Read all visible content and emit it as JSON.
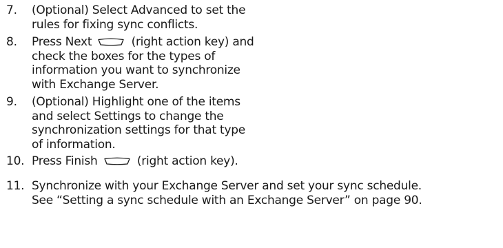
{
  "steps": [
    {
      "number": "7.",
      "lines": [
        "(Optional) Select Advanced to set the",
        "rules for fixing sync conflicts."
      ]
    },
    {
      "number": "8.",
      "line1_before_icon": "Press Next",
      "line1_after_icon": "(right action key) and",
      "lines": [
        "check the boxes for the types of",
        "information you want to synchronize",
        "with Exchange Server."
      ],
      "icon": "right-action-key-icon"
    },
    {
      "number": "9.",
      "lines": [
        "(Optional) Highlight one of the items",
        "and select Settings to change the",
        "synchronization settings for that type",
        "of information."
      ]
    },
    {
      "number": "10.",
      "line1_before_icon": "Press Finish",
      "line1_after_icon": "(right action key).",
      "icon": "right-action-key-icon"
    },
    {
      "number": "11.",
      "lines": [
        "Synchronize with your Exchange Server and set your sync schedule.",
        "See “Setting a sync schedule with an Exchange Server” on page 90."
      ]
    }
  ]
}
